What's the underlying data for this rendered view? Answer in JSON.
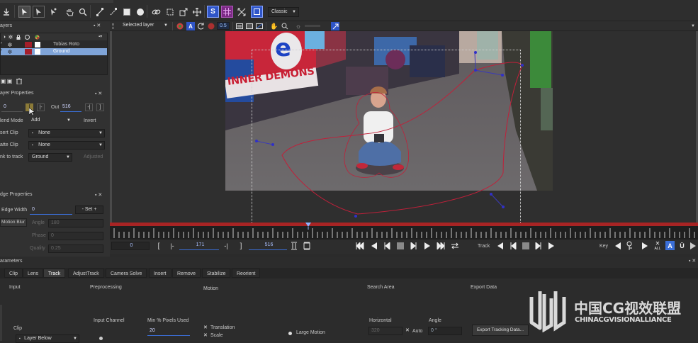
{
  "toolbar": {
    "mode_select": "Classic",
    "layer_select": "Selected layer",
    "opacity_value": "0.5",
    "s_label": "S"
  },
  "layers_panel": {
    "title": "ayers",
    "rows": [
      {
        "name": "Tobias Roto"
      },
      {
        "name": "Ground"
      }
    ]
  },
  "layer_props": {
    "title": "ayer Properties",
    "in_value": "0",
    "out_label": "Out",
    "out_value": "516",
    "blend_label": "lend Mode",
    "blend_value": "Add",
    "invert_label": "Invert",
    "insert_clip_label": "sert Clip",
    "insert_clip_value": "None",
    "matte_clip_label": "atte Clip",
    "matte_clip_value": "None",
    "link_track_label": "nk to track",
    "link_track_value": "Ground",
    "adjusted_label": "Adjusted"
  },
  "edge_props": {
    "title": "dge Properties",
    "edge_width_label": "Edge Width",
    "edge_width_value": "0",
    "set_label": "Set",
    "motion_blur_label": "Motion Blur",
    "angle_label": "Angle",
    "angle_value": "180",
    "phase_label": "Phase",
    "phase_value": "0",
    "quality_label": "Quality",
    "quality_value": "0.25"
  },
  "viewer": {
    "sign_letter": "e",
    "sign_text": "INNER DEMONS"
  },
  "timeline": {
    "current_frame": "0",
    "in_frame": "171",
    "out_frame": "516",
    "track_label": "Track",
    "key_label": "Key",
    "all_label": "ALL"
  },
  "params": {
    "title": "arameters",
    "tabs": [
      "Clip",
      "Lens",
      "Track",
      "AdjustTrack",
      "Camera Solve",
      "Insert",
      "Remove",
      "Stabilize",
      "Reorient"
    ],
    "active_tab": 2,
    "input_header": "Input",
    "preprocessing_header": "Preprocessing",
    "motion_header": "Motion",
    "search_area_header": "Search Area",
    "export_header": "Export Data",
    "clip_label": "Clip",
    "clip_value": "Layer Below",
    "input_channel_label": "Input Channel",
    "min_pixels_label": "Min % Pixels Used",
    "min_pixels_value": "20",
    "translation_label": "Translation",
    "scale_label": "Scale",
    "large_motion_label": "Large Motion",
    "horizontal_label": "Horizontal",
    "horizontal_value": "320",
    "auto_label": "Auto",
    "angle_label": "Angle",
    "angle_value": "0 °",
    "export_button": "Export Tracking Data..."
  },
  "watermark": {
    "cn_text": "中国CG视效联盟",
    "en_text": "CHINACGVISIONALLIANCE"
  },
  "colors": {
    "accent_blue": "#3b6fd8",
    "spline_red": "#c0203a",
    "timeline_red": "#a82424",
    "selection_blue": "#7fa4d8"
  }
}
